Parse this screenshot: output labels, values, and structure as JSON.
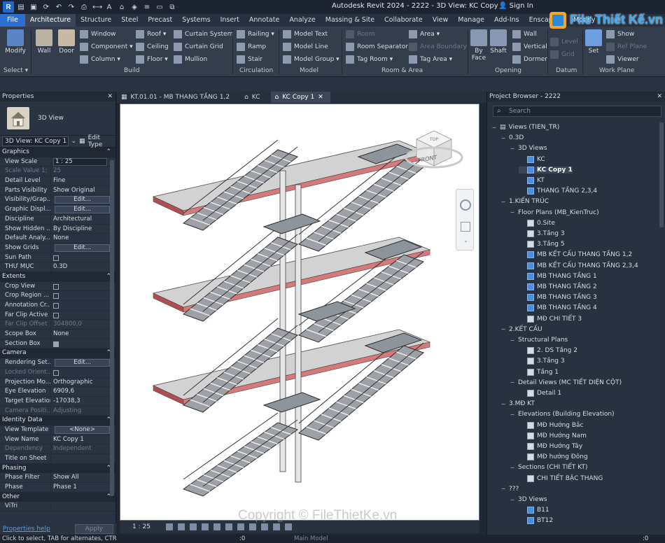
{
  "titlebar": {
    "app_letter": "R",
    "title": "Autodesk Revit 2024 - 2222 - 3D View: KC Copy 1",
    "signin": "Sign In",
    "colors": {
      "bg": "#1c2431",
      "logo": "#1f6ad1"
    }
  },
  "menu": {
    "tabs": [
      "File",
      "Architecture",
      "Structure",
      "Steel",
      "Precast",
      "Systems",
      "Insert",
      "Annotate",
      "Analyze",
      "Massing & Site",
      "Collaborate",
      "View",
      "Manage",
      "Add-Ins",
      "Enscape™",
      "Modify"
    ],
    "active": "Architecture"
  },
  "ribbon": {
    "select": {
      "modify": "Modify",
      "label": "Select ▾"
    },
    "build": {
      "label": "Build",
      "wall": "Wall",
      "door": "Door",
      "window": "Window",
      "component": "Component ▾",
      "column": "Column ▾",
      "roof": "Roof ▾",
      "ceiling": "Ceiling",
      "floor": "Floor ▾",
      "curtain_system": "Curtain System",
      "curtain_grid": "Curtain Grid",
      "mullion": "Mullion"
    },
    "circulation": {
      "label": "Circulation",
      "railing": "Railing ▾",
      "ramp": "Ramp",
      "stair": "Stair"
    },
    "model": {
      "label": "Model",
      "model_text": "Model Text",
      "model_line": "Model Line",
      "model_group": "Model Group ▾"
    },
    "room_area": {
      "label": "Room & Area",
      "room": "Room",
      "room_separator": "Room Separator",
      "tag_room": "Tag Room ▾",
      "area": "Area ▾",
      "area_boundary": "Area Boundary",
      "tag_area": "Tag Area ▾"
    },
    "opening": {
      "label": "Opening",
      "by_face": "By Face",
      "shaft": "Shaft",
      "wall": "Wall",
      "vertical": "Vertical",
      "dormer": "Dormer"
    },
    "datum": {
      "label": "Datum",
      "level": "Level",
      "grid": "Grid"
    },
    "work_plane": {
      "label": "Work Plane",
      "set": "Set",
      "show": "Show",
      "ref_plane": "Ref Plane",
      "viewer": "Viewer"
    }
  },
  "properties": {
    "title": "Properties",
    "type_name": "3D View",
    "view_selector": "3D View: KC Copy 1",
    "edit_type": "Edit Type",
    "sections": [
      {
        "name": "Graphics",
        "rows": [
          {
            "k": "View Scale",
            "v": "1 : 25",
            "kind": "input"
          },
          {
            "k": "Scale Value    1:",
            "v": "25",
            "dim": true
          },
          {
            "k": "Detail Level",
            "v": "Fine"
          },
          {
            "k": "Parts Visibility",
            "v": "Show Original"
          },
          {
            "k": "Visibility/Grap...",
            "v": "Edit...",
            "kind": "button"
          },
          {
            "k": "Graphic Displ...",
            "v": "Edit...",
            "kind": "button"
          },
          {
            "k": "Discipline",
            "v": "Architectural"
          },
          {
            "k": "Show Hidden ...",
            "v": "By Discipline"
          },
          {
            "k": "Default Analy...",
            "v": "None"
          },
          {
            "k": "Show Grids",
            "v": "Edit...",
            "kind": "button"
          },
          {
            "k": "Sun Path",
            "v": "",
            "kind": "check"
          },
          {
            "k": "THƯ MỤC",
            "v": "0.3D"
          }
        ]
      },
      {
        "name": "Extents",
        "rows": [
          {
            "k": "Crop View",
            "v": "",
            "kind": "check"
          },
          {
            "k": "Crop Region ...",
            "v": "",
            "kind": "check"
          },
          {
            "k": "Annotation Cr...",
            "v": "",
            "kind": "check"
          },
          {
            "k": "Far Clip Active",
            "v": "",
            "kind": "check"
          },
          {
            "k": "Far Clip Offset",
            "v": "304800,0",
            "dim": true
          },
          {
            "k": "Scope Box",
            "v": "None"
          },
          {
            "k": "Section Box",
            "v": "",
            "kind": "check-on"
          }
        ]
      },
      {
        "name": "Camera",
        "rows": [
          {
            "k": "Rendering Set...",
            "v": "Edit...",
            "kind": "button"
          },
          {
            "k": "Locked Orient...",
            "v": "",
            "kind": "check",
            "dim": true
          },
          {
            "k": "Projection Mo...",
            "v": "Orthographic"
          },
          {
            "k": "Eye Elevation",
            "v": "6909,6"
          },
          {
            "k": "Target Elevation",
            "v": "-17038,3"
          },
          {
            "k": "Camera Positi...",
            "v": "Adjusting",
            "dim": true
          }
        ]
      },
      {
        "name": "Identity Data",
        "rows": [
          {
            "k": "View Template",
            "v": "<None>",
            "kind": "button"
          },
          {
            "k": "View Name",
            "v": "KC Copy 1"
          },
          {
            "k": "Dependency",
            "v": "Independent",
            "dim": true
          },
          {
            "k": "Title on Sheet",
            "v": ""
          }
        ]
      },
      {
        "name": "Phasing",
        "rows": [
          {
            "k": "Phase Filter",
            "v": "Show All"
          },
          {
            "k": "Phase",
            "v": "Phase 1"
          }
        ]
      },
      {
        "name": "Other",
        "rows": [
          {
            "k": "ViTri",
            "v": ""
          }
        ]
      }
    ],
    "help": "Properties help",
    "apply": "Apply"
  },
  "doc_tabs": [
    {
      "label": "KT.01.01 - MB THANG TẦNG 1,2",
      "active": false
    },
    {
      "label": "KC",
      "active": false
    },
    {
      "label": "KC Copy 1",
      "active": true
    }
  ],
  "viewcube": {
    "top": "TOP",
    "front": "FRONT"
  },
  "view_control": {
    "scale": "1 : 25"
  },
  "project_browser": {
    "title": "Project Browser - 2222",
    "search_placeholder": "Search",
    "nodes": [
      {
        "t": "Views (TIEN_TR)",
        "lvl": 0,
        "tog": "−",
        "icon": "views"
      },
      {
        "t": "0.3D",
        "lvl": 1,
        "tog": "−"
      },
      {
        "t": "3D Views",
        "lvl": 2,
        "tog": "−"
      },
      {
        "t": "KC",
        "lvl": 3,
        "icon": "blue"
      },
      {
        "t": "KC Copy 1",
        "lvl": 3,
        "icon": "blue",
        "sel": true
      },
      {
        "t": "KT",
        "lvl": 3,
        "icon": "blue"
      },
      {
        "t": "THANG TẦNG 2,3,4",
        "lvl": 3,
        "icon": "blue"
      },
      {
        "t": "1.KIẾN TRÚC",
        "lvl": 1,
        "tog": "−"
      },
      {
        "t": "Floor Plans (MB_KienTruc)",
        "lvl": 2,
        "tog": "−"
      },
      {
        "t": "0.Site",
        "lvl": 3,
        "icon": "plain"
      },
      {
        "t": "3.Tầng 3",
        "lvl": 3,
        "icon": "plain"
      },
      {
        "t": "3.Tầng 5",
        "lvl": 3,
        "icon": "plain"
      },
      {
        "t": "MB KẾT CẤU THANG TẦNG 1,2",
        "lvl": 3,
        "icon": "blue"
      },
      {
        "t": "MB KẾT CẤU THANG TẦNG 2,3,4",
        "lvl": 3,
        "icon": "blue"
      },
      {
        "t": "MB THANG TẦNG 1",
        "lvl": 3,
        "icon": "blue"
      },
      {
        "t": "MB THANG TẦNG 2",
        "lvl": 3,
        "icon": "blue"
      },
      {
        "t": "MB THANG TẦNG 3",
        "lvl": 3,
        "icon": "blue"
      },
      {
        "t": "MB THANG TẦNG 4",
        "lvl": 3,
        "icon": "blue"
      },
      {
        "t": "MĐ CHI TIẾT 3",
        "lvl": 3,
        "icon": "plain"
      },
      {
        "t": "2.KẾT CẤU",
        "lvl": 1,
        "tog": "−"
      },
      {
        "t": "Structural Plans",
        "lvl": 2,
        "tog": "−"
      },
      {
        "t": "2. DS Tầng 2",
        "lvl": 3,
        "icon": "plain"
      },
      {
        "t": "3.Tầng 3",
        "lvl": 3,
        "icon": "plain"
      },
      {
        "t": "Tầng 1",
        "lvl": 3,
        "icon": "plain"
      },
      {
        "t": "Detail Views (MC TIẾT DIỆN CỘT)",
        "lvl": 2,
        "tog": "−"
      },
      {
        "t": "Detail 1",
        "lvl": 3,
        "icon": "plain"
      },
      {
        "t": "3.MĐ KT",
        "lvl": 1,
        "tog": "−"
      },
      {
        "t": "Elevations (Building Elevation)",
        "lvl": 2,
        "tog": "−"
      },
      {
        "t": "MĐ Hướng Bắc",
        "lvl": 3,
        "icon": "plain"
      },
      {
        "t": "MĐ Hướng Nam",
        "lvl": 3,
        "icon": "plain"
      },
      {
        "t": "MĐ Hướng Tây",
        "lvl": 3,
        "icon": "plain"
      },
      {
        "t": "MĐ hướng Đông",
        "lvl": 3,
        "icon": "plain"
      },
      {
        "t": "Sections (CHI TIẾT KT)",
        "lvl": 2,
        "tog": "−"
      },
      {
        "t": "CHI TIẾT BẬC THANG",
        "lvl": 3,
        "icon": "plain"
      },
      {
        "t": "???",
        "lvl": 1,
        "tog": "−"
      },
      {
        "t": "3D Views",
        "lvl": 2,
        "tog": "−"
      },
      {
        "t": "B11",
        "lvl": 3,
        "icon": "blue"
      },
      {
        "t": "BT12",
        "lvl": 3,
        "icon": "blue"
      }
    ]
  },
  "status": {
    "hint": "Click to select, TAB for alternates, CTR",
    "workset": ":0",
    "model": "Main Model",
    "filter": ":0"
  },
  "watermark": {
    "bottom": "Copyright © FileThietKe.vn",
    "logo": "File Thiết Kế.vn"
  }
}
